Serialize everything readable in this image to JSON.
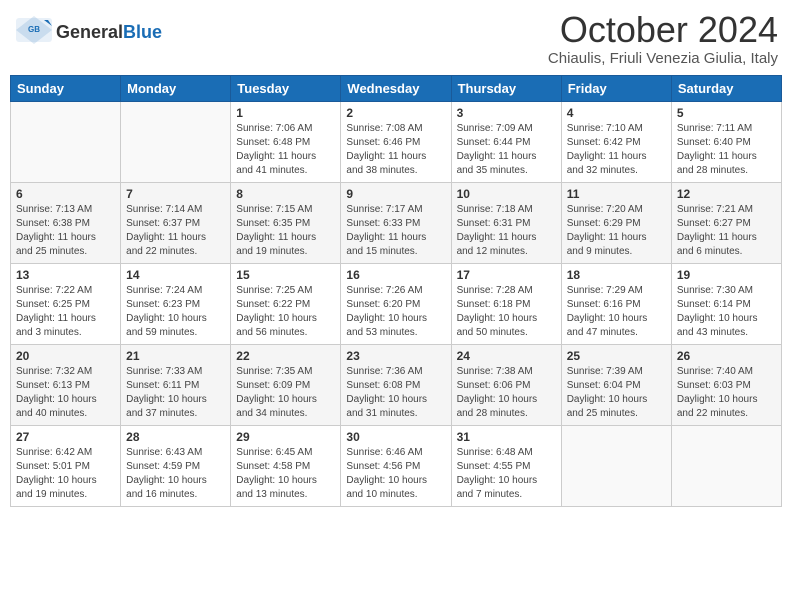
{
  "header": {
    "logo_general": "General",
    "logo_blue": "Blue",
    "title": "October 2024",
    "subtitle": "Chiaulis, Friuli Venezia Giulia, Italy"
  },
  "weekdays": [
    "Sunday",
    "Monday",
    "Tuesday",
    "Wednesday",
    "Thursday",
    "Friday",
    "Saturday"
  ],
  "weeks": [
    [
      {
        "day": "",
        "info": ""
      },
      {
        "day": "",
        "info": ""
      },
      {
        "day": "1",
        "info": "Sunrise: 7:06 AM\nSunset: 6:48 PM\nDaylight: 11 hours and 41 minutes."
      },
      {
        "day": "2",
        "info": "Sunrise: 7:08 AM\nSunset: 6:46 PM\nDaylight: 11 hours and 38 minutes."
      },
      {
        "day": "3",
        "info": "Sunrise: 7:09 AM\nSunset: 6:44 PM\nDaylight: 11 hours and 35 minutes."
      },
      {
        "day": "4",
        "info": "Sunrise: 7:10 AM\nSunset: 6:42 PM\nDaylight: 11 hours and 32 minutes."
      },
      {
        "day": "5",
        "info": "Sunrise: 7:11 AM\nSunset: 6:40 PM\nDaylight: 11 hours and 28 minutes."
      }
    ],
    [
      {
        "day": "6",
        "info": "Sunrise: 7:13 AM\nSunset: 6:38 PM\nDaylight: 11 hours and 25 minutes."
      },
      {
        "day": "7",
        "info": "Sunrise: 7:14 AM\nSunset: 6:37 PM\nDaylight: 11 hours and 22 minutes."
      },
      {
        "day": "8",
        "info": "Sunrise: 7:15 AM\nSunset: 6:35 PM\nDaylight: 11 hours and 19 minutes."
      },
      {
        "day": "9",
        "info": "Sunrise: 7:17 AM\nSunset: 6:33 PM\nDaylight: 11 hours and 15 minutes."
      },
      {
        "day": "10",
        "info": "Sunrise: 7:18 AM\nSunset: 6:31 PM\nDaylight: 11 hours and 12 minutes."
      },
      {
        "day": "11",
        "info": "Sunrise: 7:20 AM\nSunset: 6:29 PM\nDaylight: 11 hours and 9 minutes."
      },
      {
        "day": "12",
        "info": "Sunrise: 7:21 AM\nSunset: 6:27 PM\nDaylight: 11 hours and 6 minutes."
      }
    ],
    [
      {
        "day": "13",
        "info": "Sunrise: 7:22 AM\nSunset: 6:25 PM\nDaylight: 11 hours and 3 minutes."
      },
      {
        "day": "14",
        "info": "Sunrise: 7:24 AM\nSunset: 6:23 PM\nDaylight: 10 hours and 59 minutes."
      },
      {
        "day": "15",
        "info": "Sunrise: 7:25 AM\nSunset: 6:22 PM\nDaylight: 10 hours and 56 minutes."
      },
      {
        "day": "16",
        "info": "Sunrise: 7:26 AM\nSunset: 6:20 PM\nDaylight: 10 hours and 53 minutes."
      },
      {
        "day": "17",
        "info": "Sunrise: 7:28 AM\nSunset: 6:18 PM\nDaylight: 10 hours and 50 minutes."
      },
      {
        "day": "18",
        "info": "Sunrise: 7:29 AM\nSunset: 6:16 PM\nDaylight: 10 hours and 47 minutes."
      },
      {
        "day": "19",
        "info": "Sunrise: 7:30 AM\nSunset: 6:14 PM\nDaylight: 10 hours and 43 minutes."
      }
    ],
    [
      {
        "day": "20",
        "info": "Sunrise: 7:32 AM\nSunset: 6:13 PM\nDaylight: 10 hours and 40 minutes."
      },
      {
        "day": "21",
        "info": "Sunrise: 7:33 AM\nSunset: 6:11 PM\nDaylight: 10 hours and 37 minutes."
      },
      {
        "day": "22",
        "info": "Sunrise: 7:35 AM\nSunset: 6:09 PM\nDaylight: 10 hours and 34 minutes."
      },
      {
        "day": "23",
        "info": "Sunrise: 7:36 AM\nSunset: 6:08 PM\nDaylight: 10 hours and 31 minutes."
      },
      {
        "day": "24",
        "info": "Sunrise: 7:38 AM\nSunset: 6:06 PM\nDaylight: 10 hours and 28 minutes."
      },
      {
        "day": "25",
        "info": "Sunrise: 7:39 AM\nSunset: 6:04 PM\nDaylight: 10 hours and 25 minutes."
      },
      {
        "day": "26",
        "info": "Sunrise: 7:40 AM\nSunset: 6:03 PM\nDaylight: 10 hours and 22 minutes."
      }
    ],
    [
      {
        "day": "27",
        "info": "Sunrise: 6:42 AM\nSunset: 5:01 PM\nDaylight: 10 hours and 19 minutes."
      },
      {
        "day": "28",
        "info": "Sunrise: 6:43 AM\nSunset: 4:59 PM\nDaylight: 10 hours and 16 minutes."
      },
      {
        "day": "29",
        "info": "Sunrise: 6:45 AM\nSunset: 4:58 PM\nDaylight: 10 hours and 13 minutes."
      },
      {
        "day": "30",
        "info": "Sunrise: 6:46 AM\nSunset: 4:56 PM\nDaylight: 10 hours and 10 minutes."
      },
      {
        "day": "31",
        "info": "Sunrise: 6:48 AM\nSunset: 4:55 PM\nDaylight: 10 hours and 7 minutes."
      },
      {
        "day": "",
        "info": ""
      },
      {
        "day": "",
        "info": ""
      }
    ]
  ]
}
